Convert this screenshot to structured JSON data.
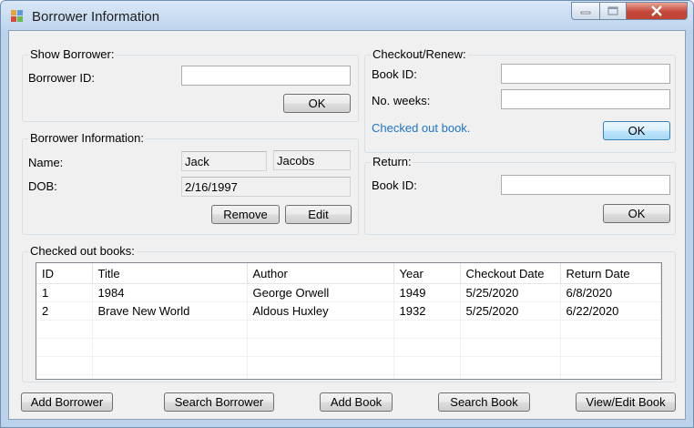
{
  "window": {
    "title": "Borrower Information"
  },
  "show_borrower": {
    "label": "Show Borrower:",
    "id_label": "Borrower ID:",
    "id_value": "",
    "ok": "OK"
  },
  "borrower_info": {
    "label": "Borrower Information:",
    "name_label": "Name:",
    "first_name": "Jack",
    "last_name": "Jacobs",
    "dob_label": "DOB:",
    "dob": "2/16/1997",
    "remove": "Remove",
    "edit": "Edit"
  },
  "checkout": {
    "label": "Checkout/Renew:",
    "book_id_label": "Book ID:",
    "book_id_value": "",
    "weeks_label": "No. weeks:",
    "weeks_value": "",
    "status": "Checked out book.",
    "ok": "OK"
  },
  "return_section": {
    "label": "Return:",
    "book_id_label": "Book ID:",
    "book_id_value": "",
    "ok": "OK"
  },
  "checked_out": {
    "label": "Checked out books:",
    "columns": [
      "ID",
      "Title",
      "Author",
      "Year",
      "Checkout Date",
      "Return Date"
    ],
    "rows": [
      [
        "1",
        "1984",
        "George Orwell",
        "1949",
        "5/25/2020",
        "6/8/2020"
      ],
      [
        "2",
        "Brave New World",
        "Aldous Huxley",
        "1932",
        "5/25/2020",
        "6/22/2020"
      ]
    ]
  },
  "bottom_buttons": {
    "add_borrower": "Add Borrower",
    "search_borrower": "Search Borrower",
    "add_book": "Add Book",
    "search_book": "Search Book",
    "view_edit_book": "View/Edit Book"
  },
  "colors": {
    "status_text": "#1e73c8",
    "title_bar": "#bfd5ee",
    "close_button": "#c4473a"
  }
}
